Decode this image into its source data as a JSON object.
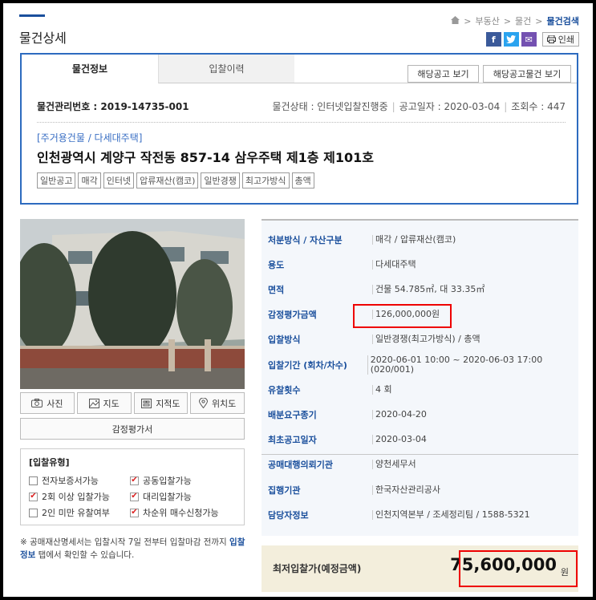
{
  "page": {
    "title": "물건상세",
    "breadcrumb": [
      "부동산",
      "물건",
      "물건검색"
    ],
    "share": {
      "facebook": "f",
      "twitter": "t",
      "mail": "✉",
      "print": "인쇄"
    }
  },
  "tabs": [
    {
      "label": "물건정보",
      "active": true
    },
    {
      "label": "입찰이력",
      "active": false
    }
  ],
  "buttons": {
    "notice": "해당공고 보기",
    "notice_items": "해당공고물건 보기"
  },
  "meta": {
    "mgmt_no": "물건관리번호 : 2019-14735-001",
    "status": "물건상태 : 인터넷입찰진행중",
    "notice_date": "공고일자 : 2020-03-04",
    "views": "조회수 : 447"
  },
  "property": {
    "category": "[주거용건물 / 다세대주택]",
    "address": "인천광역시 계양구 작전동 857-14 삼우주택 제1층 제101호",
    "tags": [
      "일반공고",
      "매각",
      "인터넷",
      "압류재산(캠코)",
      "일반경쟁",
      "최고가방식",
      "총액"
    ]
  },
  "photo_buttons": [
    {
      "label": "사진",
      "icon": "camera-icon"
    },
    {
      "label": "지도",
      "icon": "map-icon"
    },
    {
      "label": "지적도",
      "icon": "cadastral-map-icon"
    },
    {
      "label": "위치도",
      "icon": "location-pin-icon"
    }
  ],
  "appraisal_doc": "감정평가서",
  "bid_type": {
    "title": "[입찰유형]",
    "items": [
      {
        "label": "전자보증서가능",
        "checked": false
      },
      {
        "label": "공동입찰가능",
        "checked": true
      },
      {
        "label": "2회 이상 입찰가능",
        "checked": true
      },
      {
        "label": "대리입찰가능",
        "checked": true
      },
      {
        "label": "2인 미만 유찰여부",
        "checked": false
      },
      {
        "label": "차순위 매수신청가능",
        "checked": true
      }
    ]
  },
  "footnote": {
    "before": "※ 공매재산명세서는 입찰시작 7일 전부터 입찰마감 전까지 ",
    "link": "입찰정보",
    "after": " 탭에서 확인할 수 있습니다."
  },
  "details": [
    {
      "label": "처분방식 / 자산구분",
      "value": "매각 / 압류재산(캠코)"
    },
    {
      "label": "용도",
      "value": "다세대주택"
    },
    {
      "label": "면적",
      "value": "건물 54.785㎡, 대 33.35㎡"
    },
    {
      "label": "감정평가금액",
      "value": "126,000,000원",
      "highlight": true
    },
    {
      "label": "입찰방식",
      "value": "일반경쟁(최고가방식) / 총액"
    },
    {
      "label": "입찰기간 (회차/차수)",
      "value": "2020-06-01 10:00 ~ 2020-06-03 17:00 (020/001)"
    },
    {
      "label": "유찰횟수",
      "value": "4 회"
    },
    {
      "label": "배분요구종기",
      "value": "2020-04-20"
    },
    {
      "label": "최초공고일자",
      "value": "2020-03-04"
    },
    {
      "label": "공매대행의뢰기관",
      "value": "양천세무서"
    },
    {
      "label": "집행기관",
      "value": "한국자산관리공사"
    },
    {
      "label": "담당자정보",
      "value": "인천지역본부 / 조세정리팀 / 1588-5321"
    }
  ],
  "min_bid": {
    "label": "최저입찰가(예정금액)",
    "value": "75,600,000",
    "unit": "원"
  },
  "colors": {
    "accent": "#1a4f9c",
    "box_border": "#2d6bbf",
    "highlight": "#e00000",
    "min_bg": "#f3eedc"
  }
}
